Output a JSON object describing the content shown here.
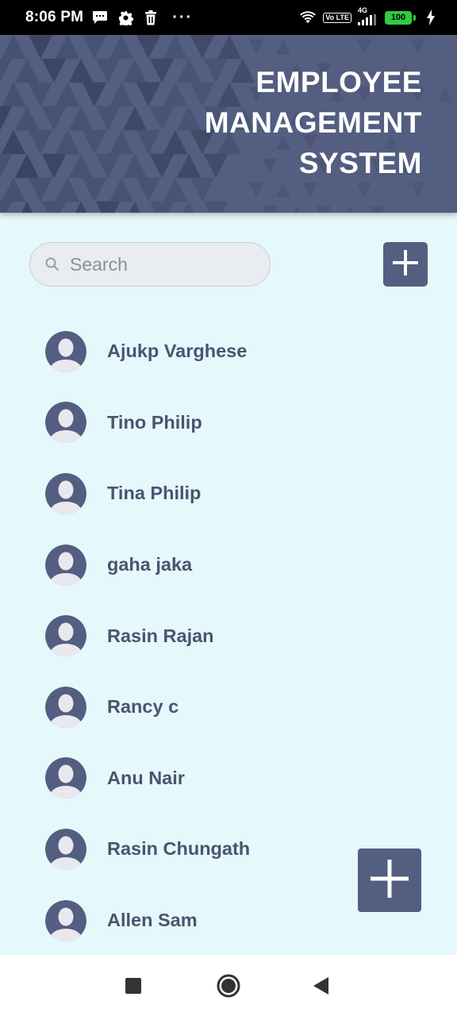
{
  "status_bar": {
    "time": "8:06 PM",
    "dots": "···",
    "network_type": "4G",
    "volte": "Vo LTE",
    "battery_level": "100",
    "icons": [
      "message-icon",
      "settings-gear-icon",
      "trash-icon",
      "wifi-icon",
      "signal-icon",
      "battery-icon",
      "charging-bolt-icon"
    ]
  },
  "header": {
    "title_lines": [
      "EMPLOYEE",
      "MANAGEMENT",
      "SYSTEM"
    ]
  },
  "search": {
    "placeholder": "Search",
    "value": ""
  },
  "employees": [
    {
      "name": "Ajukp Varghese"
    },
    {
      "name": "Tino Philip"
    },
    {
      "name": "Tina Philip"
    },
    {
      "name": "gaha jaka"
    },
    {
      "name": "Rasin Rajan"
    },
    {
      "name": "Rancy c"
    },
    {
      "name": "Anu Nair"
    },
    {
      "name": "Rasin Chungath"
    },
    {
      "name": "Allen Sam"
    }
  ],
  "buttons": {
    "add_top_icon": "plus-icon",
    "fab_icon": "plus-icon"
  },
  "nav": {
    "icons": [
      "recents-square-icon",
      "home-circle-icon",
      "back-triangle-icon"
    ]
  },
  "colors": {
    "primary": "#535e80",
    "background": "#e5f8fb",
    "name_text": "#4a5470"
  }
}
